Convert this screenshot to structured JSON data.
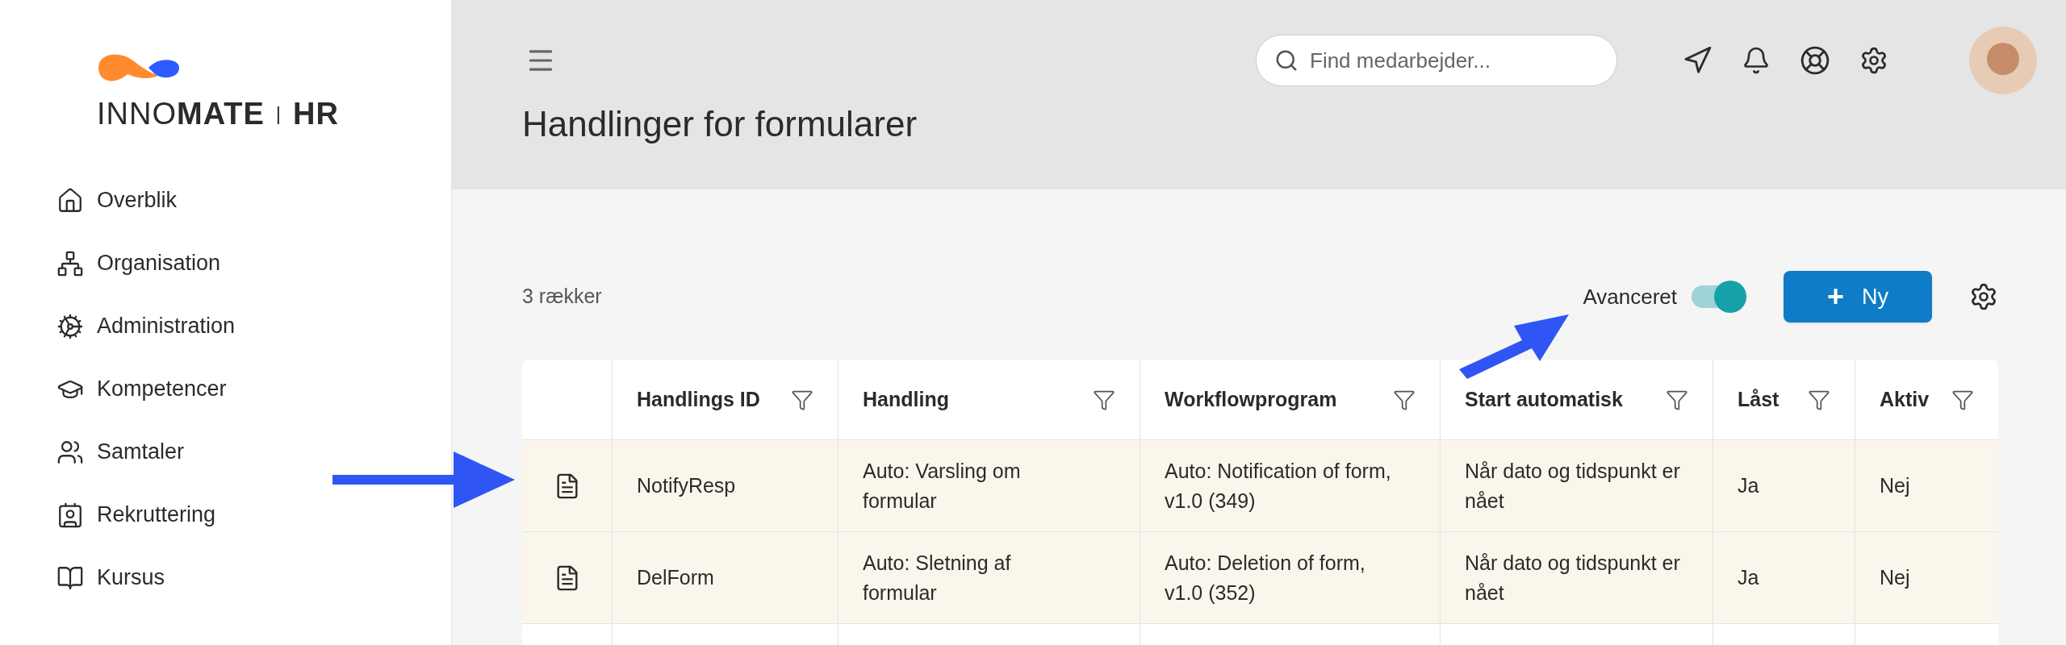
{
  "logo": {
    "light": "INNO",
    "bold": "MATE",
    "separator": "|",
    "product": "HR"
  },
  "sidebar": {
    "items": [
      {
        "label": "Overblik"
      },
      {
        "label": "Organisation"
      },
      {
        "label": "Administration"
      },
      {
        "label": "Kompetencer"
      },
      {
        "label": "Samtaler"
      },
      {
        "label": "Rekruttering"
      },
      {
        "label": "Kursus"
      }
    ]
  },
  "header": {
    "search": {
      "placeholder": "Find medarbejder..."
    },
    "title": "Handlinger for formularer"
  },
  "toolbar": {
    "row_count": "3 rækker",
    "advanced": {
      "label": "Avanceret",
      "on": true
    },
    "new_button": {
      "icon": "+",
      "label": "Ny"
    }
  },
  "table": {
    "columns": [
      "Handlings ID",
      "Handling",
      "Workflowprogram",
      "Start automatisk",
      "Låst",
      "Aktiv"
    ],
    "rows": [
      {
        "cells": [
          "NotifyResp",
          "Auto: Varsling om formular",
          "Auto: Notification of form, v1.0 (349)",
          "Når dato og tidspunkt er nået",
          "Ja",
          "Nej"
        ]
      },
      {
        "cells": [
          "DelForm",
          "Auto: Sletning af formular",
          "Auto: Deletion of form, v1.0 (352)",
          "Når dato og tidspunkt er nået",
          "Ja",
          "Nej"
        ]
      }
    ]
  }
}
